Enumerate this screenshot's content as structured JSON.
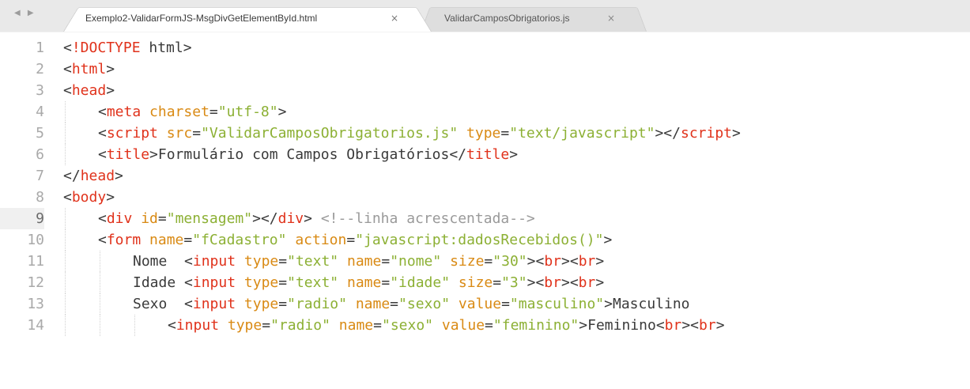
{
  "tabs": [
    {
      "label": "Exemplo2-ValidarFormJS-MsgDivGetElementById.html",
      "close": "×",
      "active": true
    },
    {
      "label": "ValidarCamposObrigatorios.js",
      "close": "×",
      "active": false
    }
  ],
  "nav_arrows": "◀ ▶",
  "current_line": 9,
  "lines": [
    {
      "n": "1",
      "indent": 0,
      "tokens": [
        [
          "p",
          "<"
        ],
        [
          "tag",
          "!DOCTYPE"
        ],
        [
          "t",
          " html"
        ],
        [
          "p",
          ">"
        ]
      ]
    },
    {
      "n": "2",
      "indent": 0,
      "tokens": [
        [
          "p",
          "<"
        ],
        [
          "tag",
          "html"
        ],
        [
          "p",
          ">"
        ]
      ]
    },
    {
      "n": "3",
      "indent": 0,
      "tokens": [
        [
          "p",
          "<"
        ],
        [
          "tag",
          "head"
        ],
        [
          "p",
          ">"
        ]
      ]
    },
    {
      "n": "4",
      "indent": 1,
      "tokens": [
        [
          "p",
          "<"
        ],
        [
          "tag",
          "meta"
        ],
        [
          "t",
          " "
        ],
        [
          "attr",
          "charset"
        ],
        [
          "p",
          "="
        ],
        [
          "val",
          "\"utf-8\""
        ],
        [
          "p",
          ">"
        ]
      ]
    },
    {
      "n": "5",
      "indent": 1,
      "tokens": [
        [
          "p",
          "<"
        ],
        [
          "tag",
          "script"
        ],
        [
          "t",
          " "
        ],
        [
          "attr",
          "src"
        ],
        [
          "p",
          "="
        ],
        [
          "val",
          "\"ValidarCamposObrigatorios.js\""
        ],
        [
          "t",
          " "
        ],
        [
          "attr",
          "type"
        ],
        [
          "p",
          "="
        ],
        [
          "val",
          "\"text/javascript\""
        ],
        [
          "p",
          "></"
        ],
        [
          "tag",
          "script"
        ],
        [
          "p",
          ">"
        ]
      ]
    },
    {
      "n": "6",
      "indent": 1,
      "tokens": [
        [
          "p",
          "<"
        ],
        [
          "tag",
          "title"
        ],
        [
          "p",
          ">"
        ],
        [
          "t",
          "Formulário com Campos Obrigatórios"
        ],
        [
          "p",
          "</"
        ],
        [
          "tag",
          "title"
        ],
        [
          "p",
          ">"
        ]
      ]
    },
    {
      "n": "7",
      "indent": 0,
      "tokens": [
        [
          "p",
          "</"
        ],
        [
          "tag",
          "head"
        ],
        [
          "p",
          ">"
        ]
      ]
    },
    {
      "n": "8",
      "indent": 0,
      "tokens": [
        [
          "p",
          "<"
        ],
        [
          "tag",
          "body"
        ],
        [
          "p",
          ">"
        ]
      ]
    },
    {
      "n": "9",
      "indent": 1,
      "tokens": [
        [
          "p",
          "<"
        ],
        [
          "tag",
          "div"
        ],
        [
          "t",
          " "
        ],
        [
          "attr",
          "id"
        ],
        [
          "p",
          "="
        ],
        [
          "val",
          "\"mensagem\""
        ],
        [
          "p",
          "></"
        ],
        [
          "tag",
          "div"
        ],
        [
          "p",
          ">"
        ],
        [
          "t",
          " "
        ],
        [
          "comment",
          "<!--linha acrescentada-->"
        ]
      ]
    },
    {
      "n": "10",
      "indent": 1,
      "tokens": [
        [
          "p",
          "<"
        ],
        [
          "tag",
          "form"
        ],
        [
          "t",
          " "
        ],
        [
          "attr",
          "name"
        ],
        [
          "p",
          "="
        ],
        [
          "val",
          "\"fCadastro\""
        ],
        [
          "t",
          " "
        ],
        [
          "attr",
          "action"
        ],
        [
          "p",
          "="
        ],
        [
          "val",
          "\"javascript:dadosRecebidos()\""
        ],
        [
          "p",
          ">"
        ]
      ]
    },
    {
      "n": "11",
      "indent": 2,
      "tokens": [
        [
          "t",
          "Nome  "
        ],
        [
          "p",
          "<"
        ],
        [
          "tag",
          "input"
        ],
        [
          "t",
          " "
        ],
        [
          "attr",
          "type"
        ],
        [
          "p",
          "="
        ],
        [
          "val",
          "\"text\""
        ],
        [
          "t",
          " "
        ],
        [
          "attr",
          "name"
        ],
        [
          "p",
          "="
        ],
        [
          "val",
          "\"nome\""
        ],
        [
          "t",
          " "
        ],
        [
          "attr",
          "size"
        ],
        [
          "p",
          "="
        ],
        [
          "val",
          "\"30\""
        ],
        [
          "p",
          "><"
        ],
        [
          "tag",
          "br"
        ],
        [
          "p",
          "><"
        ],
        [
          "tag",
          "br"
        ],
        [
          "p",
          ">"
        ]
      ]
    },
    {
      "n": "12",
      "indent": 2,
      "tokens": [
        [
          "t",
          "Idade "
        ],
        [
          "p",
          "<"
        ],
        [
          "tag",
          "input"
        ],
        [
          "t",
          " "
        ],
        [
          "attr",
          "type"
        ],
        [
          "p",
          "="
        ],
        [
          "val",
          "\"text\""
        ],
        [
          "t",
          " "
        ],
        [
          "attr",
          "name"
        ],
        [
          "p",
          "="
        ],
        [
          "val",
          "\"idade\""
        ],
        [
          "t",
          " "
        ],
        [
          "attr",
          "size"
        ],
        [
          "p",
          "="
        ],
        [
          "val",
          "\"3\""
        ],
        [
          "p",
          "><"
        ],
        [
          "tag",
          "br"
        ],
        [
          "p",
          "><"
        ],
        [
          "tag",
          "br"
        ],
        [
          "p",
          ">"
        ]
      ]
    },
    {
      "n": "13",
      "indent": 2,
      "tokens": [
        [
          "t",
          "Sexo  "
        ],
        [
          "p",
          "<"
        ],
        [
          "tag",
          "input"
        ],
        [
          "t",
          " "
        ],
        [
          "attr",
          "type"
        ],
        [
          "p",
          "="
        ],
        [
          "val",
          "\"radio\""
        ],
        [
          "t",
          " "
        ],
        [
          "attr",
          "name"
        ],
        [
          "p",
          "="
        ],
        [
          "val",
          "\"sexo\""
        ],
        [
          "t",
          " "
        ],
        [
          "attr",
          "value"
        ],
        [
          "p",
          "="
        ],
        [
          "val",
          "\"masculino\""
        ],
        [
          "p",
          ">"
        ],
        [
          "t",
          "Masculino"
        ]
      ]
    },
    {
      "n": "14",
      "indent": 3,
      "tokens": [
        [
          "p",
          "<"
        ],
        [
          "tag",
          "input"
        ],
        [
          "t",
          " "
        ],
        [
          "attr",
          "type"
        ],
        [
          "p",
          "="
        ],
        [
          "val",
          "\"radio\""
        ],
        [
          "t",
          " "
        ],
        [
          "attr",
          "name"
        ],
        [
          "p",
          "="
        ],
        [
          "val",
          "\"sexo\""
        ],
        [
          "t",
          " "
        ],
        [
          "attr",
          "value"
        ],
        [
          "p",
          "="
        ],
        [
          "val",
          "\"feminino\""
        ],
        [
          "p",
          ">"
        ],
        [
          "t",
          "Feminino"
        ],
        [
          "p",
          "<"
        ],
        [
          "tag",
          "br"
        ],
        [
          "p",
          "><"
        ],
        [
          "tag",
          "br"
        ],
        [
          "p",
          ">"
        ]
      ]
    }
  ],
  "colors": {
    "tag": "#e0321b",
    "attribute": "#d98a14",
    "string": "#8cb034",
    "comment": "#9a9a9a",
    "text": "#3a3a3a",
    "gutter": "#a9a9a9"
  }
}
